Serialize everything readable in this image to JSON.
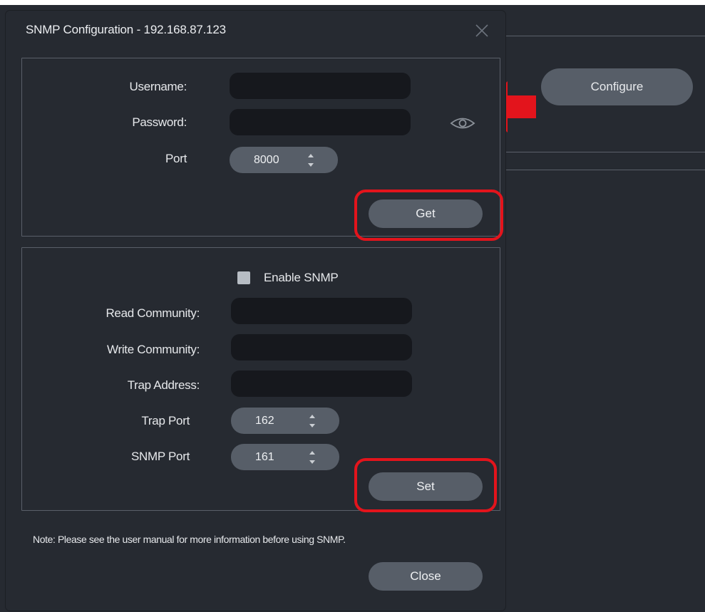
{
  "background": {
    "configure_label": "Configure"
  },
  "dialog": {
    "title": "SNMP Configuration - 192.168.87.123",
    "close_icon": "close-x-icon",
    "login": {
      "username_label": "Username:",
      "username_value": "",
      "password_label": "Password:",
      "password_value": "",
      "show_password_icon": "eye-icon",
      "port_label": "Port",
      "port_value": "8000",
      "get_label": "Get"
    },
    "snmp": {
      "enable_label": "Enable SNMP",
      "enable_checked": false,
      "read_community_label": "Read Community:",
      "read_community_value": "",
      "write_community_label": "Write Community:",
      "write_community_value": "",
      "trap_address_label": "Trap Address:",
      "trap_address_value": "",
      "trap_port_label": "Trap Port",
      "trap_port_value": "162",
      "snmp_port_label": "SNMP Port",
      "snmp_port_value": "161",
      "set_label": "Set"
    },
    "note": "Note: Please see the user manual for more information before using SNMP.",
    "close_label": "Close"
  },
  "colors": {
    "background": "#262a31",
    "field": "#16181d",
    "button": "#575e68",
    "annotation_red": "#e3141c"
  }
}
